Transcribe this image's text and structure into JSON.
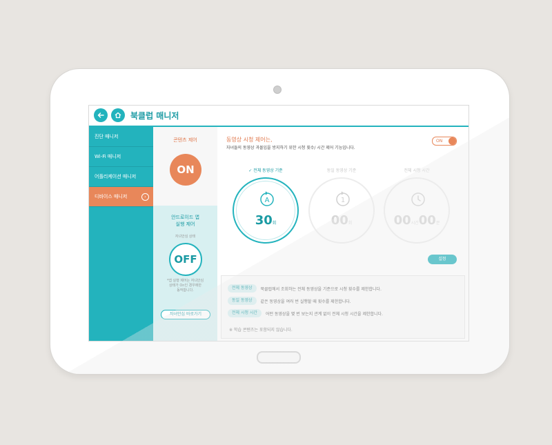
{
  "header": {
    "title": "북클럽 매니저"
  },
  "sidebar": {
    "items": [
      {
        "label": "진단 매니저"
      },
      {
        "label": "Wi-Fi 매니저"
      },
      {
        "label": "어플리케이션 매니저"
      },
      {
        "label": "디바이스 매니저",
        "active": true
      }
    ]
  },
  "content_control": {
    "label": "콘텐츠 제어",
    "state": "ON"
  },
  "android_control": {
    "label_line1": "안드로이드 앱",
    "label_line2": "실행 제어",
    "status_label": "자녀안심 상태",
    "state": "OFF",
    "note_line1": "*앱 실행 제어는 자녀안심",
    "note_line2": "상태가 On인 경우에만",
    "note_line3": "동작합니다.",
    "link_button": "자녀안심 바로가기"
  },
  "main": {
    "title": "동영상 시청 제어는,",
    "subtitle": "자녀들의 동영상 과몰입을 방지하기 위한 시청 횟수/ 시간 제어 기능입니다.",
    "toggle_label": "ON",
    "gauges": [
      {
        "label": "✓ 전체 동영상 기준",
        "value": "30",
        "unit": "회",
        "selected": true
      },
      {
        "label": "동일 동영상 기준",
        "value": "00",
        "unit": "회",
        "selected": false
      },
      {
        "label": "전체 시청 시간",
        "value_hours": "00",
        "unit_hours": "시간",
        "value_minutes": "00",
        "unit_minutes": "분",
        "selected": false
      }
    ],
    "setting_button": "설정",
    "info": [
      {
        "tag": "전체 동영상",
        "desc": "북클럽에서 조회하는 전체 동영상을 기준으로 시청 횟수를 제한합니다."
      },
      {
        "tag": "동일 동영상",
        "desc": "같은 동영상을 여러 번 실행할 때 횟수를 제한합니다."
      },
      {
        "tag": "전체 시청 시간",
        "desc": "어떤 동영상을 몇 번 보는지 관계 없이 전체 시청 시간을 제한합니다."
      }
    ],
    "note": "※ 학습 콘텐츠는 포함되지 않습니다."
  },
  "colors": {
    "teal": "#23b3bd",
    "orange": "#e8875a",
    "light_teal": "#d8f0f1"
  }
}
